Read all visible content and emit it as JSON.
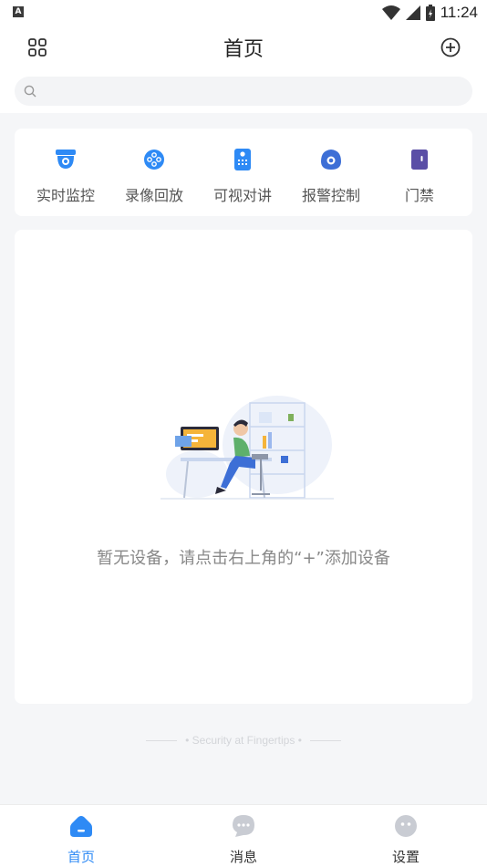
{
  "status_bar": {
    "notification_letter": "A",
    "time": "11:24"
  },
  "header": {
    "title": "首页"
  },
  "search": {
    "placeholder": ""
  },
  "quick_actions": [
    {
      "label": "实时监控",
      "icon": "camera-icon"
    },
    {
      "label": "录像回放",
      "icon": "playback-icon"
    },
    {
      "label": "可视对讲",
      "icon": "intercom-icon"
    },
    {
      "label": "报警控制",
      "icon": "alarm-icon"
    },
    {
      "label": "门禁",
      "icon": "door-icon"
    }
  ],
  "empty_state": {
    "message": "暂无设备，请点击右上角的“+”添加设备"
  },
  "footer": {
    "slogan": "Security at Fingertips"
  },
  "tabs": [
    {
      "label": "首页",
      "icon": "home-icon",
      "active": true
    },
    {
      "label": "消息",
      "icon": "message-icon",
      "active": false
    },
    {
      "label": "设置",
      "icon": "settings-icon",
      "active": false
    }
  ],
  "colors": {
    "accent": "#2e8af5",
    "alarm": "#3d6fd6",
    "door": "#5a4ea6",
    "inactive_tab": "#c9ccd3"
  }
}
